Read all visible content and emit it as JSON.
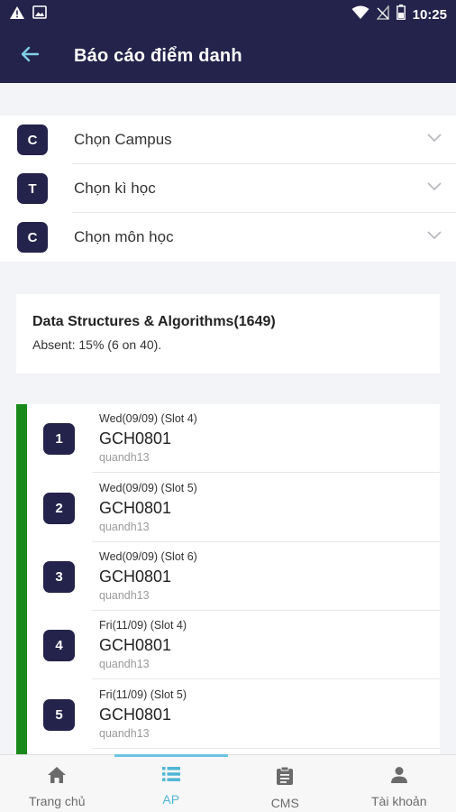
{
  "status_bar": {
    "time": "10:25"
  },
  "app_bar": {
    "title": "Báo cáo điểm danh"
  },
  "selectors": [
    {
      "badge": "C",
      "label": "Chọn Campus"
    },
    {
      "badge": "T",
      "label": "Chọn kì học"
    },
    {
      "badge": "C",
      "label": "Chọn môn học"
    }
  ],
  "summary": {
    "title": "Data Structures & Algorithms(1649)",
    "subtitle": "Absent: 15% (6 on 40)."
  },
  "sessions": [
    {
      "num": "1",
      "date": "Wed(09/09) (Slot 4)",
      "code": "GCH0801",
      "teacher": "quandh13"
    },
    {
      "num": "2",
      "date": "Wed(09/09) (Slot 5)",
      "code": "GCH0801",
      "teacher": "quandh13"
    },
    {
      "num": "3",
      "date": "Wed(09/09) (Slot 6)",
      "code": "GCH0801",
      "teacher": "quandh13"
    },
    {
      "num": "4",
      "date": "Fri(11/09) (Slot 4)",
      "code": "GCH0801",
      "teacher": "quandh13"
    },
    {
      "num": "5",
      "date": "Fri(11/09) (Slot 5)",
      "code": "GCH0801",
      "teacher": "quandh13"
    }
  ],
  "bottom_nav": [
    {
      "label": "Trang chủ",
      "icon": "home-icon"
    },
    {
      "label": "AP",
      "icon": "list-icon"
    },
    {
      "label": "CMS",
      "icon": "clipboard-icon"
    },
    {
      "label": "Tài khoản",
      "icon": "person-icon"
    }
  ],
  "colors": {
    "primary": "#23234b",
    "accent": "#4fb6d6",
    "present_bar": "#1a8a1a"
  }
}
